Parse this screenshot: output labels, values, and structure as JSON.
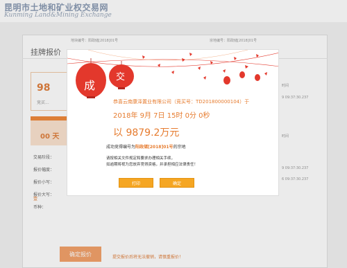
{
  "site": {
    "name_cn": "昆明市土地和矿业权交易网",
    "name_en": "Kunming Land&Mining Exchange"
  },
  "page": {
    "parcel_label_1": "地块编号：阳政储[2018]01号",
    "parcel_label_2": "宗地编号：阳政储[2018]01号",
    "section_title": "挂牌报价",
    "current_price": "98",
    "current_price_caption": "竞买...",
    "countdown": "00 天",
    "form_labels": [
      "交易阶段：",
      "报价幅度：",
      "报价小写：",
      "报价大写：",
      "币种："
    ],
    "form_red_value": "壹",
    "right_col_1": "时间",
    "right_col_2": "9 09:37:30.237",
    "right_col_3": "时间",
    "right_col_4": "9 09:37:30.237",
    "right_col_5": "6 09:37:30.237",
    "submit_label": "确定报价",
    "hint": "提交报价后将无法撤销，请慎重报价！"
  },
  "modal": {
    "deal_char_1": "成",
    "deal_char_2": "交",
    "winner": "恭喜云南康泽置业有限公司（竞买号：TD201800000104）于",
    "datetime": "2018年 9月 7日 15时 0分 0秒",
    "final_price": "以 9879.2万元",
    "lot_prefix": "成功竞得编号为",
    "lot_id": "阳政储[2018]01号",
    "lot_suffix": "的宗地",
    "notice_1": "请按相关文件规定和要求办理相关手续，",
    "notice_2": "如逾期将视为您放弃竞得资格，并承担相应法律责任！",
    "print_label": "打印",
    "ok_label": "确定"
  },
  "colors": {
    "accent": "#e67b2e",
    "lantern": "#e3382c",
    "button": "#f5a623"
  }
}
